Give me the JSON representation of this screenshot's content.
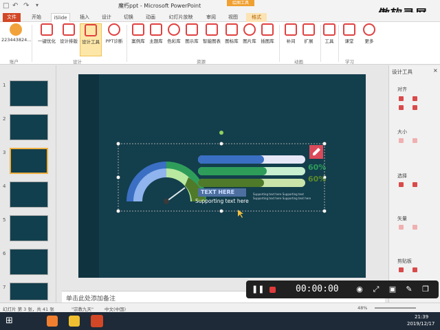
{
  "titlebar": {
    "title": "魔朽ppt - Microsoft PowerPoint",
    "context_group": "绘图工具",
    "brand": "傲软录屏"
  },
  "tabs": [
    {
      "label": "文件"
    },
    {
      "label": "开始"
    },
    {
      "label": "iSlide"
    },
    {
      "label": "插入"
    },
    {
      "label": "设计"
    },
    {
      "label": "切换"
    },
    {
      "label": "动画"
    },
    {
      "label": "幻灯片放映"
    },
    {
      "label": "审阅"
    },
    {
      "label": "视图"
    },
    {
      "label": "格式"
    }
  ],
  "ribbon": {
    "account": "223443824...",
    "account_group": "账户",
    "design_group": "设计",
    "resource_group": "资源",
    "animation_group": "动画",
    "learning_group": "学习",
    "buttons": [
      {
        "label": "一键优化"
      },
      {
        "label": "设计排版"
      },
      {
        "label": "设计工具"
      },
      {
        "label": "PPT诊断"
      },
      {
        "label": "案例库"
      },
      {
        "label": "主题库"
      },
      {
        "label": "色彩库"
      },
      {
        "label": "图示库"
      },
      {
        "label": "智能图表"
      },
      {
        "label": "图标库"
      },
      {
        "label": "图片库"
      },
      {
        "label": "插图库"
      },
      {
        "label": "补间"
      },
      {
        "label": "扩展"
      },
      {
        "label": "工具"
      },
      {
        "label": "课堂"
      },
      {
        "label": "更多"
      }
    ]
  },
  "thumbnails": [
    {
      "num": "1"
    },
    {
      "num": "2"
    },
    {
      "num": "3"
    },
    {
      "num": "4"
    },
    {
      "num": "5"
    },
    {
      "num": "6"
    },
    {
      "num": "7"
    }
  ],
  "slide": {
    "pct1": "60%",
    "pct2": "60%",
    "text_here": "TEXT HERE",
    "supporting": "Supporting  text here",
    "small1": "Supporting text here Supporting text",
    "small2": "Supporting text here Supporting text here"
  },
  "notes_placeholder": "单击此处添加备注",
  "right_panel": {
    "title": "设计工具",
    "sections": [
      "对齐",
      "大小",
      "选择",
      "矢量",
      "剪贴板"
    ]
  },
  "status": {
    "slide_info": "幻灯片 第 3 张，共 41 张",
    "theme": "\"宗教九天\"",
    "language": "中文(中国)",
    "zoom": "48%"
  },
  "recorder": {
    "timer": "00:00:00"
  },
  "taskbar": {
    "time": "21:39",
    "date": "2019/12/17"
  }
}
